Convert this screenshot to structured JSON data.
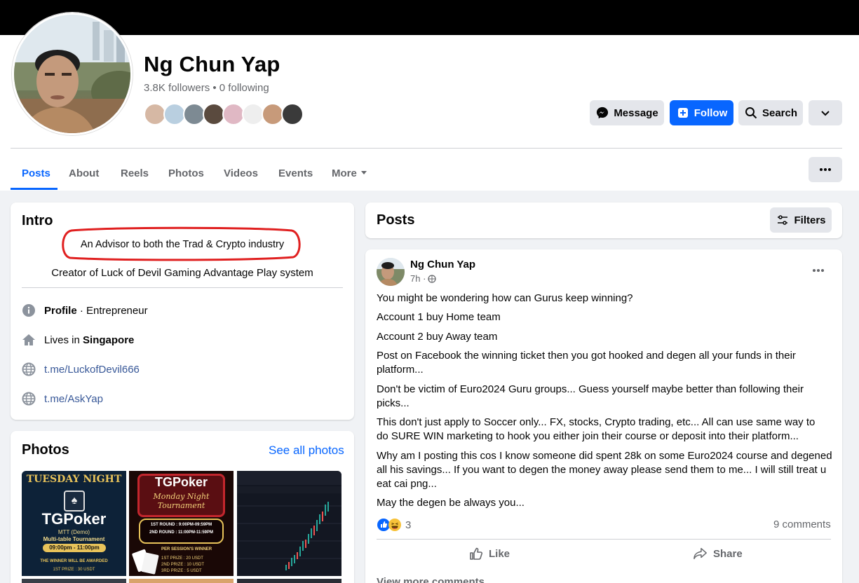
{
  "profile": {
    "name": "Ng Chun Yap",
    "followers_line": "3.8K followers • 0 following"
  },
  "header_actions": {
    "message_label": "Message",
    "follow_label": "Follow",
    "search_label": "Search"
  },
  "tabs": [
    {
      "label": "Posts"
    },
    {
      "label": "About"
    },
    {
      "label": "Reels"
    },
    {
      "label": "Photos"
    },
    {
      "label": "Videos"
    },
    {
      "label": "Events"
    },
    {
      "label": "More"
    }
  ],
  "intro": {
    "title": "Intro",
    "bio_1": "An Advisor to both the Trad & Crypto industry",
    "bio_2": "Creator of Luck of Devil Gaming Advantage Play system",
    "profile_bold": "Profile",
    "profile_rest": " · Entrepreneur",
    "lives_prefix": "Lives in ",
    "lives_city": "Singapore",
    "link_1": "t.me/LuckofDevil666",
    "link_2": "t.me/AskYap"
  },
  "photos": {
    "title": "Photos",
    "see_all": "See all photos",
    "thumb_1": {
      "line1": "TUESDAY NIGHT",
      "brand": "TGPoker",
      "line2": "MTT (Demo)",
      "line3": "Multi-table Tournament",
      "time": "09:00pm - 11:00pm",
      "foot": "THE WINNER WILL BE AWARDED",
      "foot2": "1ST PRIZE : 30 USDT"
    },
    "thumb_2": {
      "brand": "TGPoker",
      "line1": "Monday Night",
      "line2": "Tournament",
      "r1": "1ST ROUND : 9:00PM-09:59PM",
      "r2": "2ND ROUND : 11:00PM-11:59PM",
      "winner": "PER SESSION'S WINNER",
      "p1": "1ST PRIZE : 20 USDT",
      "p2": "2ND PRIZE : 10 USDT",
      "p3": "3RD PRIZE : 5 USDT"
    }
  },
  "posts_header": {
    "title": "Posts",
    "filters_label": "Filters"
  },
  "post": {
    "author": "Ng Chun Yap",
    "time": "7h ·",
    "lines": [
      "You might be wondering how can Gurus keep winning?",
      "Account 1 buy Home team",
      "Account 2 buy Away team",
      "Post on Facebook the winning ticket then you got hooked and degen all your funds in their platform...",
      "Don't be victim of Euro2024 Guru groups... Guess yourself maybe better than following their picks...",
      "This don't just apply to Soccer only... FX, stocks, Crypto trading, etc... All can use same way to do SURE WIN marketing to hook you either join their course or deposit into their platform...",
      "Why am I posting this cos I know someone did spent 28k on some Euro2024 course and degened all his savings... If you want to degen the money away please send them to me... I will still treat u eat cai png...",
      "May the degen be always you..."
    ],
    "reaction_count": "3",
    "comments": "9 comments",
    "like_label": "Like",
    "share_label": "Share",
    "view_more": "View more comments"
  },
  "colors": {
    "accent": "#0866ff",
    "highlight_ring": "#e02020"
  }
}
